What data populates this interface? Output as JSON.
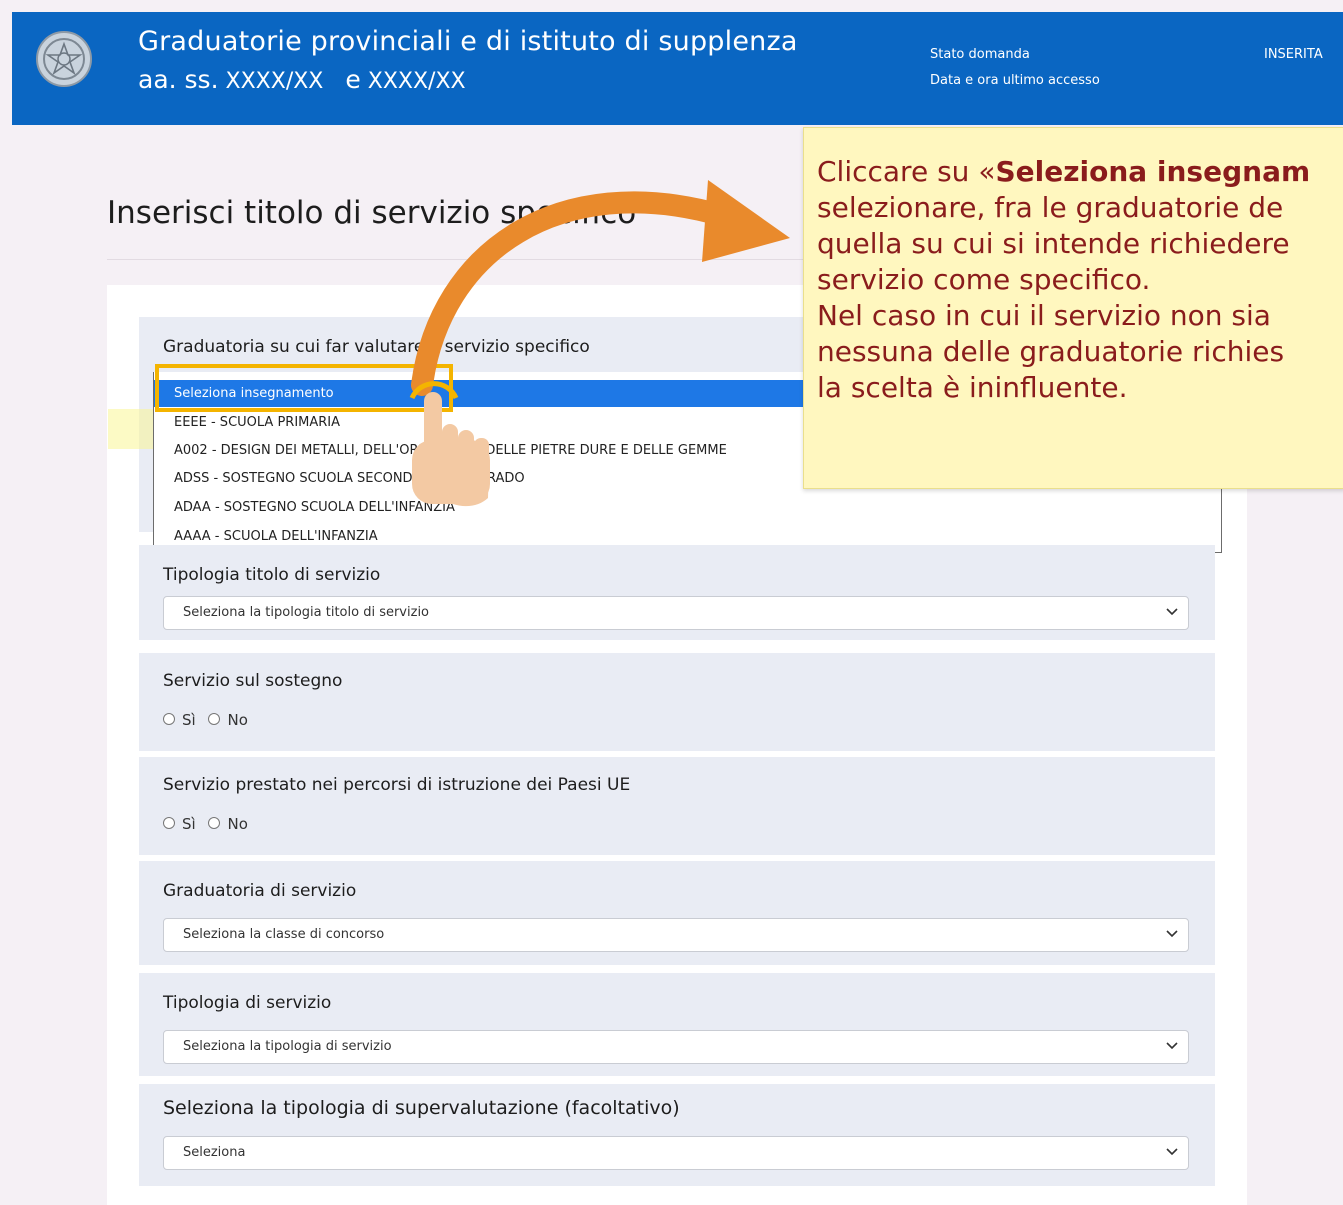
{
  "header": {
    "title": "Graduatorie provinciali e di istituto di supplenza",
    "subtitle_prefix": "aa. ss.",
    "subtitle_year1": "XXXX/XX",
    "subtitle_conj": "e",
    "subtitle_year2": "XXXX/XX",
    "status_label": "Stato domanda",
    "last_access_label": "Data e ora ultimo accesso",
    "status_value": "INSERITA"
  },
  "page": {
    "title": "Inserisci titolo di servizio specifico"
  },
  "form": {
    "graduatoria_label": "Graduatoria su cui far valutare il servizio specifico",
    "graduatoria_options": [
      "Seleziona insegnamento",
      "EEEE - SCUOLA PRIMARIA",
      "A002 - DESIGN DEI METALLI, DELL'OREFICERIA, DELLE PIETRE DURE E DELLE GEMME",
      "ADSS - SOSTEGNO SCUOLA SECONDARIA DI II GRADO",
      "ADAA - SOSTEGNO SCUOLA DELL'INFANZIA",
      "AAAA - SCUOLA DELL'INFANZIA"
    ],
    "tipologia_titolo_label": "Tipologia titolo di servizio",
    "tipologia_titolo_placeholder": "Seleziona la tipologia titolo di servizio",
    "sostegno_label": "Servizio sul sostegno",
    "ue_label": "Servizio prestato nei percorsi di istruzione dei Paesi UE",
    "radio_yes": "Sì",
    "radio_no": "No",
    "graduatoria_servizio_label": "Graduatoria di servizio",
    "graduatoria_servizio_placeholder": "Seleziona la classe di concorso",
    "tipologia_servizio_label": "Tipologia di servizio",
    "tipologia_servizio_placeholder": "Seleziona la tipologia di servizio",
    "supervalutazione_label": "Seleziona la tipologia di supervalutazione (facoltativo)",
    "supervalutazione_placeholder": "Seleziona"
  },
  "callout": {
    "line1_pre": "Cliccare su «",
    "line1_bold": "Seleziona insegnam",
    "line2": "selezionare, fra le graduatorie de",
    "line3": "quella su cui si intende richiedere",
    "line4": "servizio come specifico.",
    "line5": "Nel caso in cui il servizio non sia",
    "line6": "nessuna delle graduatorie richies",
    "line7": "la scelta è ininfluente."
  },
  "colors": {
    "header_bg": "#0a66c2",
    "selected_option_bg": "#1e78e6",
    "callout_bg": "#fff7bf",
    "callout_text": "#8a1c1c",
    "highlight_border": "#f4b400",
    "arrow": "#e98a2c"
  },
  "icons": [
    "emblem-icon",
    "chevron-down-icon",
    "curved-arrow-icon",
    "pointing-hand-icon",
    "radio-icon"
  ]
}
